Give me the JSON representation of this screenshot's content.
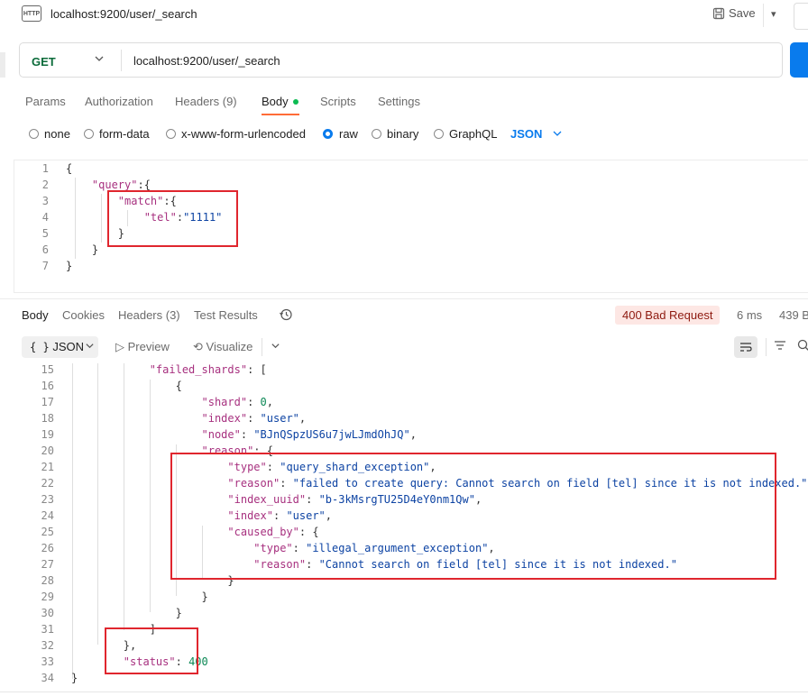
{
  "app": {
    "http_badge": "HTTP",
    "request_title": "localhost:9200/user/_search",
    "save_label": "Save"
  },
  "request": {
    "method": "GET",
    "url": "localhost:9200/user/_search",
    "tabs": [
      {
        "label": "Params"
      },
      {
        "label": "Authorization"
      },
      {
        "label": "Headers (9)"
      },
      {
        "label": "Body"
      },
      {
        "label": "Scripts"
      },
      {
        "label": "Settings"
      }
    ],
    "body_types": [
      "none",
      "form-data",
      "x-www-form-urlencoded",
      "raw",
      "binary",
      "GraphQL"
    ],
    "selected_body_type": "raw",
    "language": "JSON",
    "code_lines": [
      {
        "n": "1",
        "t": "{"
      },
      {
        "n": "2",
        "t": "    \"query\":{"
      },
      {
        "n": "3",
        "t": "        \"match\":{"
      },
      {
        "n": "4",
        "t": "            \"tel\":\"1111\""
      },
      {
        "n": "5",
        "t": "        }"
      },
      {
        "n": "6",
        "t": "    }"
      },
      {
        "n": "7",
        "t": "}"
      }
    ]
  },
  "response": {
    "tabs": [
      {
        "label": "Body"
      },
      {
        "label": "Cookies"
      },
      {
        "label": "Headers (3)"
      },
      {
        "label": "Test Results"
      }
    ],
    "status": "400 Bad Request",
    "time": "6 ms",
    "size": "439 B",
    "format": "JSON",
    "preview_label": "Preview",
    "visualize_label": "Visualize",
    "code_lines": [
      {
        "n": "15",
        "t": "            \"failed_shards\": ["
      },
      {
        "n": "16",
        "t": "                {"
      },
      {
        "n": "17",
        "t": "                    \"shard\": 0,"
      },
      {
        "n": "18",
        "t": "                    \"index\": \"user\","
      },
      {
        "n": "19",
        "t": "                    \"node\": \"BJnQSpzUS6u7jwLJmdOhJQ\","
      },
      {
        "n": "20",
        "t": "                    \"reason\": {"
      },
      {
        "n": "21",
        "t": "                        \"type\": \"query_shard_exception\","
      },
      {
        "n": "22",
        "t": "                        \"reason\": \"failed to create query: Cannot search on field [tel] since it is not indexed.\","
      },
      {
        "n": "23",
        "t": "                        \"index_uuid\": \"b-3kMsrgTU25D4eY0nm1Qw\","
      },
      {
        "n": "24",
        "t": "                        \"index\": \"user\","
      },
      {
        "n": "25",
        "t": "                        \"caused_by\": {"
      },
      {
        "n": "26",
        "t": "                            \"type\": \"illegal_argument_exception\","
      },
      {
        "n": "27",
        "t": "                            \"reason\": \"Cannot search on field [tel] since it is not indexed.\""
      },
      {
        "n": "28",
        "t": "                        }"
      },
      {
        "n": "29",
        "t": "                    }"
      },
      {
        "n": "30",
        "t": "                }"
      },
      {
        "n": "31",
        "t": "            ]"
      },
      {
        "n": "32",
        "t": "        },"
      },
      {
        "n": "33",
        "t": "        \"status\": 400"
      },
      {
        "n": "34",
        "t": "}"
      }
    ]
  },
  "colors": {
    "accent": "#097bed",
    "tab_underline": "#ff6c37",
    "status_bg": "#fde7e4",
    "status_fg": "#8e1a10",
    "highlight": "#e0262e"
  }
}
